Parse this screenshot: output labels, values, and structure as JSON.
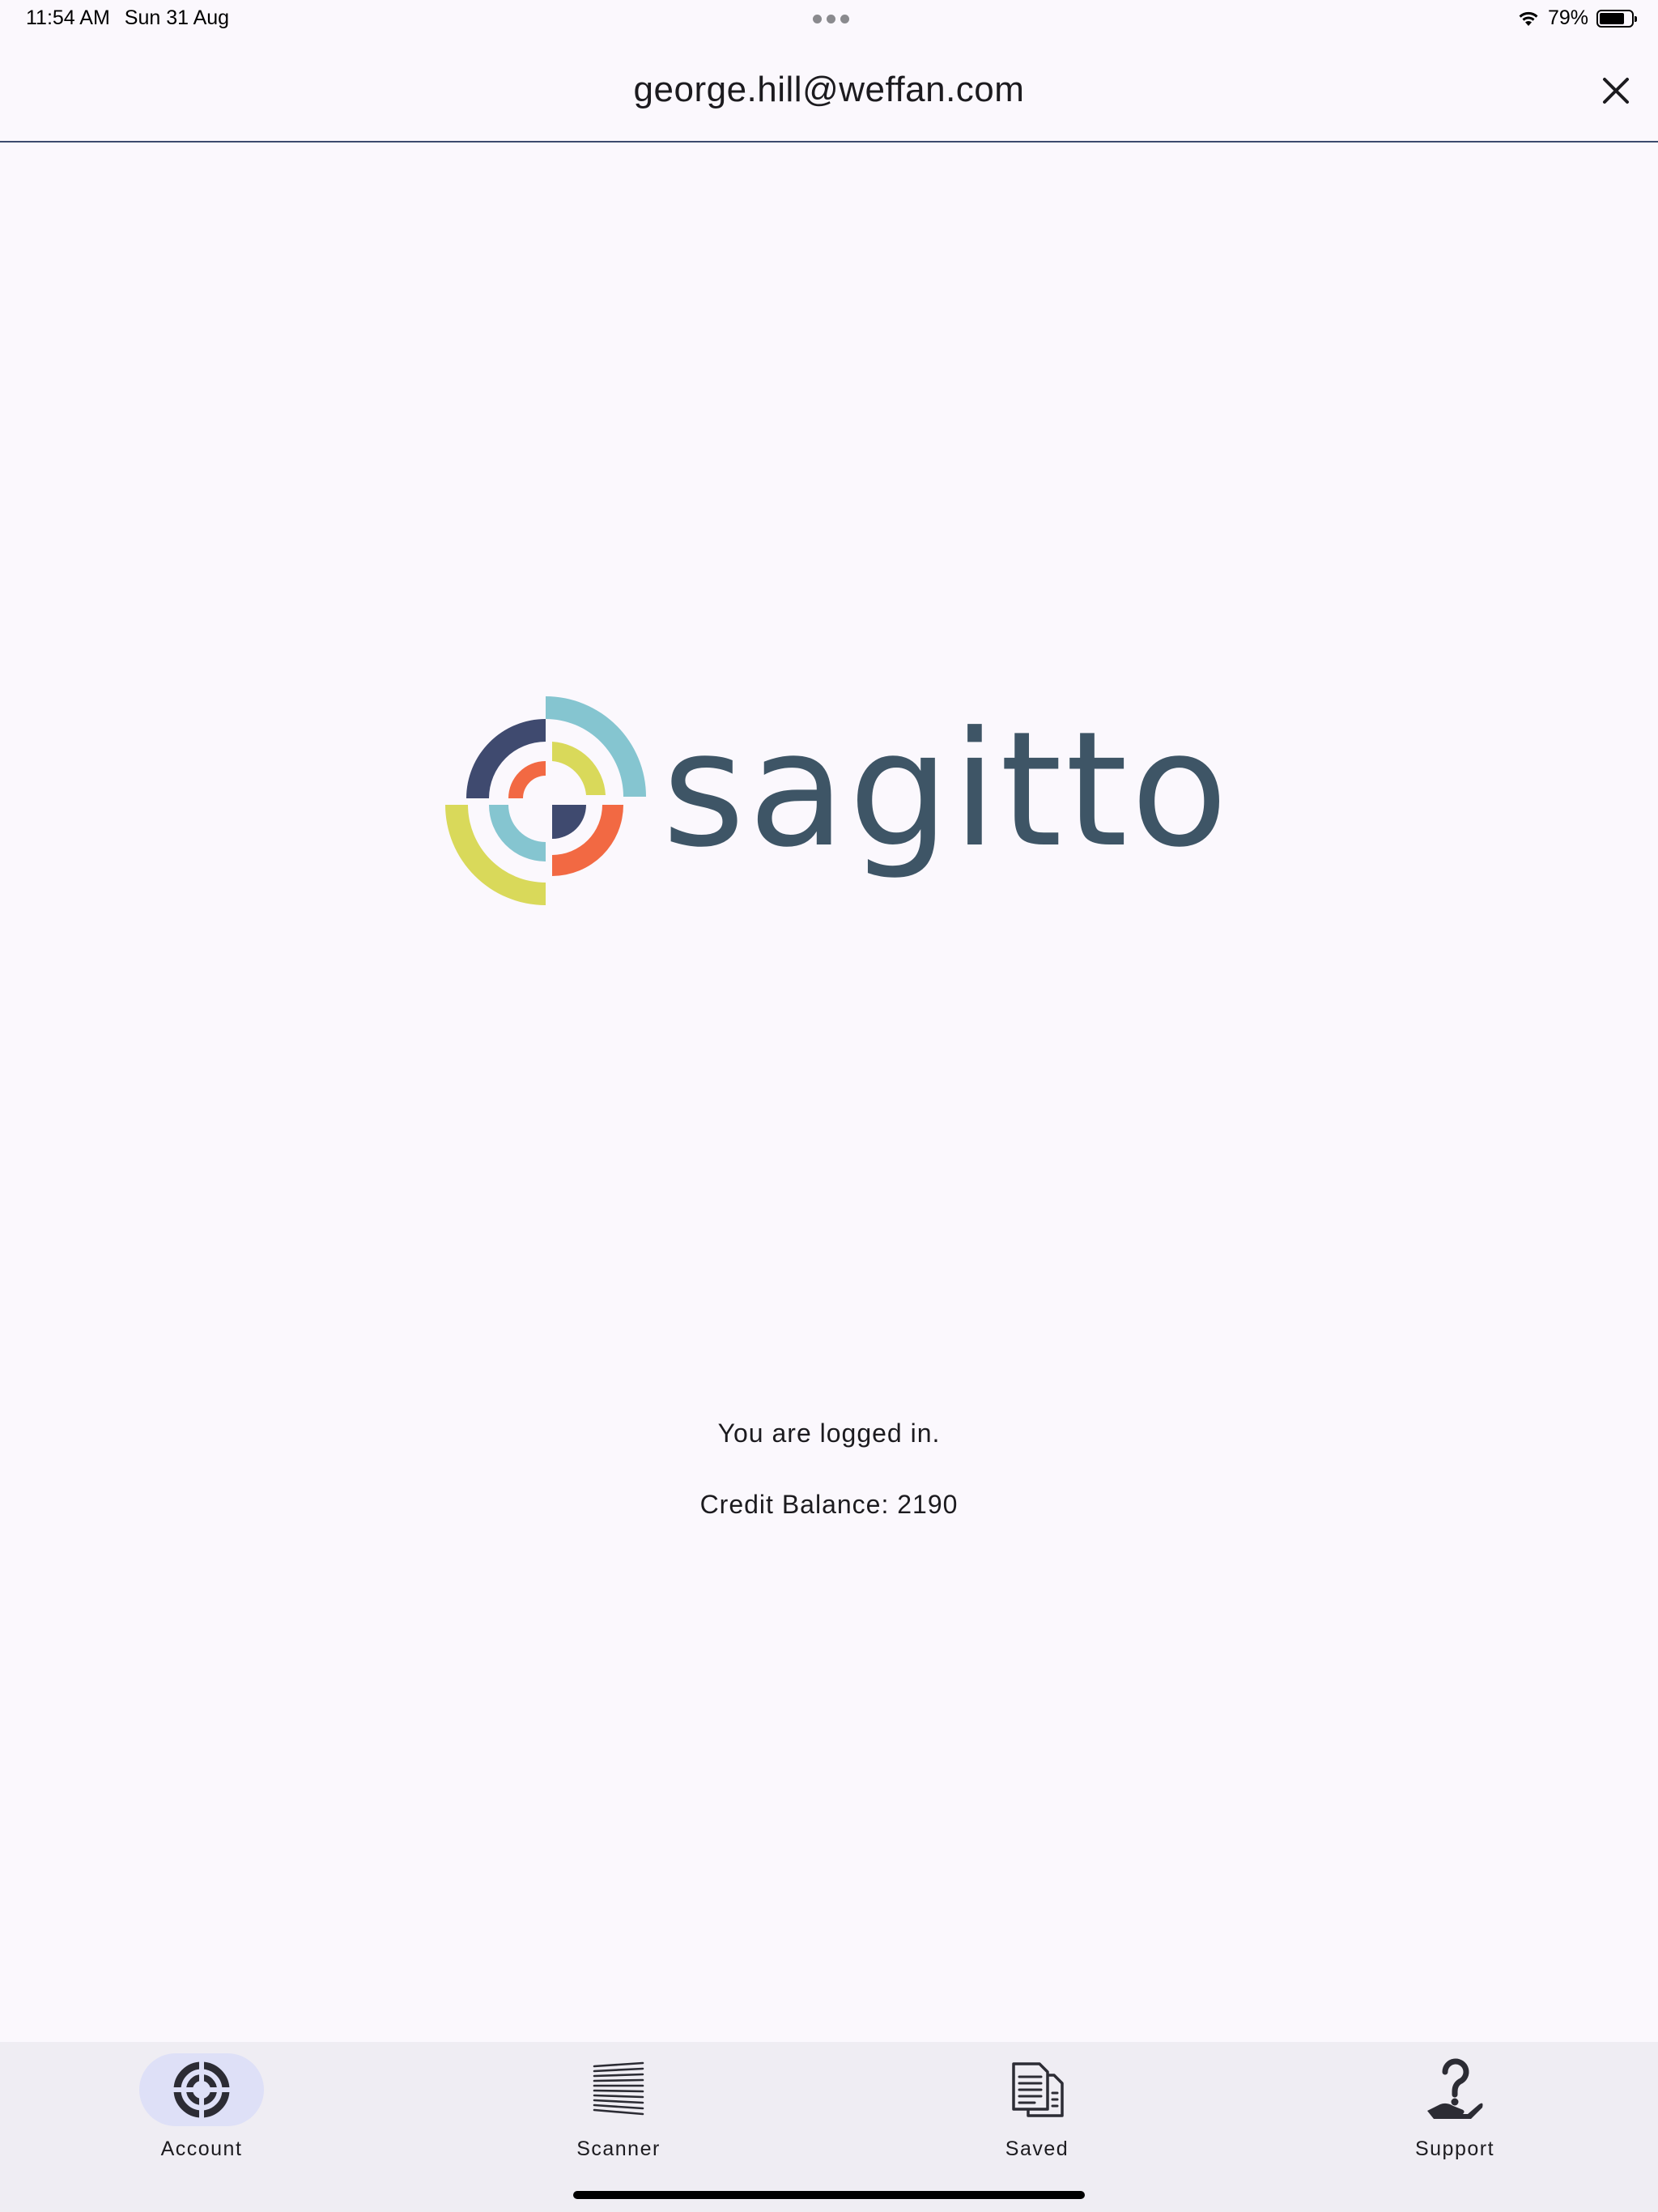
{
  "status_bar": {
    "time": "11:54 AM",
    "date": "Sun 31 Aug",
    "battery": "79%",
    "battery_level": 0.79
  },
  "header": {
    "title": "george.hill@weffan.com"
  },
  "logo": {
    "wordmark": "sagitto",
    "colors": {
      "navy": "#3f4a6f",
      "teal": "#85c5d0",
      "yellow": "#d9d95a",
      "orange": "#f26943",
      "text": "#3e5566"
    }
  },
  "main": {
    "status_text": "You are logged in.",
    "credit_balance": "Credit Balance: 2190"
  },
  "bottom_nav": {
    "items": [
      {
        "label": "Account",
        "icon": "target-icon",
        "active": true
      },
      {
        "label": "Scanner",
        "icon": "scanner-icon",
        "active": false
      },
      {
        "label": "Saved",
        "icon": "document-icon",
        "active": false
      },
      {
        "label": "Support",
        "icon": "help-hand-icon",
        "active": false
      }
    ]
  }
}
